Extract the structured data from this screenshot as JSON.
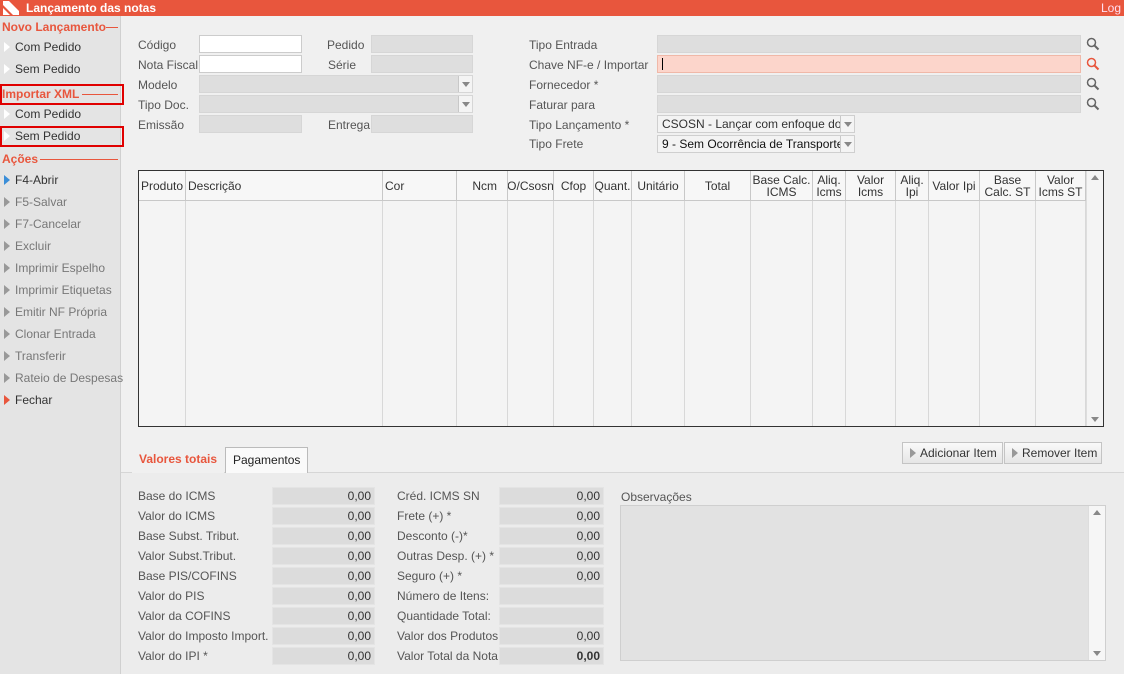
{
  "window": {
    "title": "Lançamento das notas",
    "log_label": "Log"
  },
  "sidebar": {
    "sections": [
      {
        "title": "Novo Lançamento",
        "items": [
          {
            "label": "Com Pedido"
          },
          {
            "label": "Sem Pedido"
          }
        ]
      },
      {
        "title": "Importar XML",
        "items": [
          {
            "label": "Com Pedido"
          },
          {
            "label": "Sem Pedido"
          }
        ]
      },
      {
        "title": "Ações",
        "items": [
          {
            "label": "F4-Abrir"
          },
          {
            "label": "F5-Salvar"
          },
          {
            "label": "F7-Cancelar"
          },
          {
            "label": "Excluir"
          },
          {
            "label": "Imprimir Espelho"
          },
          {
            "label": "Imprimir Etiquetas"
          },
          {
            "label": "Emitir NF Própria"
          },
          {
            "label": "Clonar Entrada"
          },
          {
            "label": "Transferir"
          },
          {
            "label": "Rateio de Despesas"
          },
          {
            "label": "Fechar"
          }
        ]
      }
    ]
  },
  "form": {
    "codigo": {
      "label": "Código",
      "value": ""
    },
    "pedido": {
      "label": "Pedido",
      "value": ""
    },
    "nota_fiscal": {
      "label": "Nota Fiscal",
      "value": ""
    },
    "serie": {
      "label": "Série",
      "value": ""
    },
    "modelo": {
      "label": "Modelo",
      "value": ""
    },
    "tipo_doc": {
      "label": "Tipo Doc.",
      "value": ""
    },
    "emissao": {
      "label": "Emissão",
      "value": ""
    },
    "entrega": {
      "label": "Entrega",
      "value": ""
    },
    "tipo_entrada": {
      "label": "Tipo Entrada",
      "value": ""
    },
    "chave_nfe": {
      "label": "Chave NF-e / Importar",
      "value": ""
    },
    "fornecedor": {
      "label": "Fornecedor *",
      "value": ""
    },
    "faturar_para": {
      "label": "Faturar para",
      "value": ""
    },
    "tipo_lancamento": {
      "label": "Tipo Lançamento *",
      "value": "CSOSN - Lançar com enfoque do"
    },
    "tipo_frete": {
      "label": "Tipo Frete",
      "value": "9 - Sem Ocorrência de Transporte"
    }
  },
  "grid": {
    "columns": [
      "Produto",
      "Descrição",
      "Cor",
      "Ncm",
      "O/Csosn",
      "Cfop",
      "Quant.",
      "Unitário",
      "Total",
      "Base Calc. ICMS",
      "Aliq. Icms",
      "Valor Icms",
      "Aliq. Ipi",
      "Valor Ipi",
      "Base Calc. ST",
      "Valor Icms ST"
    ],
    "rows": []
  },
  "tabs": {
    "valores_totais": "Valores totais",
    "pagamentos": "Pagamentos"
  },
  "buttons": {
    "adicionar_item": "Adicionar Item",
    "remover_item": "Remover Item"
  },
  "totals_left": [
    {
      "label": "Base do ICMS",
      "value": "0,00"
    },
    {
      "label": "Valor do ICMS",
      "value": "0,00"
    },
    {
      "label": "Base Subst. Tribut.",
      "value": "0,00"
    },
    {
      "label": "Valor Subst.Tribut.",
      "value": "0,00"
    },
    {
      "label": "Base PIS/COFINS",
      "value": "0,00"
    },
    {
      "label": "Valor do PIS",
      "value": "0,00"
    },
    {
      "label": "Valor da COFINS",
      "value": "0,00"
    },
    {
      "label": "Valor do Imposto Import.",
      "value": "0,00"
    },
    {
      "label": "Valor do IPI *",
      "value": "0,00"
    }
  ],
  "totals_right": [
    {
      "label": "Créd. ICMS SN",
      "value": "0,00"
    },
    {
      "label": "Frete (+) *",
      "value": "0,00"
    },
    {
      "label": "Desconto (-)*",
      "value": "0,00"
    },
    {
      "label": "Outras Desp. (+) *",
      "value": "0,00"
    },
    {
      "label": "Seguro (+) *",
      "value": "0,00"
    },
    {
      "label": "Número de Itens:",
      "value": ""
    },
    {
      "label": "Quantidade Total:",
      "value": ""
    },
    {
      "label": "Valor dos Produtos",
      "value": "0,00"
    },
    {
      "label": "Valor Total da Nota",
      "value": "0,00"
    }
  ],
  "observacoes": {
    "label": "Observações",
    "value": ""
  },
  "colors": {
    "accent": "#e8563d",
    "highlight_box": "#e00000",
    "chave_bg": "#fcd5cb"
  }
}
